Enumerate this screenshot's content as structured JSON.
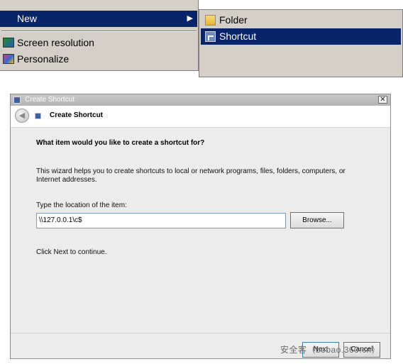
{
  "context_menu": {
    "new_label": "New",
    "screen_resolution_label": "Screen resolution",
    "personalize_label": "Personalize"
  },
  "submenu": {
    "folder_label": "Folder",
    "shortcut_label": "Shortcut"
  },
  "dialog": {
    "window_title": "Create Shortcut",
    "header_title": "Create Shortcut",
    "question": "What item would you like to create a shortcut for?",
    "description": "This wizard helps you to create shortcuts to local or network programs, files, folders, computers, or Internet addresses.",
    "location_label": "Type the location of the item:",
    "location_value": "\\\\127.0.0.1\\c$",
    "browse_label": "Browse...",
    "continue_text": "Click Next to continue.",
    "next_label": "Next",
    "cancel_label": "Cancel",
    "close_glyph": "✕"
  },
  "watermark": "安全客（bobao.360.cn）",
  "colors": {
    "menu_highlight": "#0a246a",
    "menu_bg": "#d4d0c8",
    "dialog_bg": "#ececec"
  }
}
